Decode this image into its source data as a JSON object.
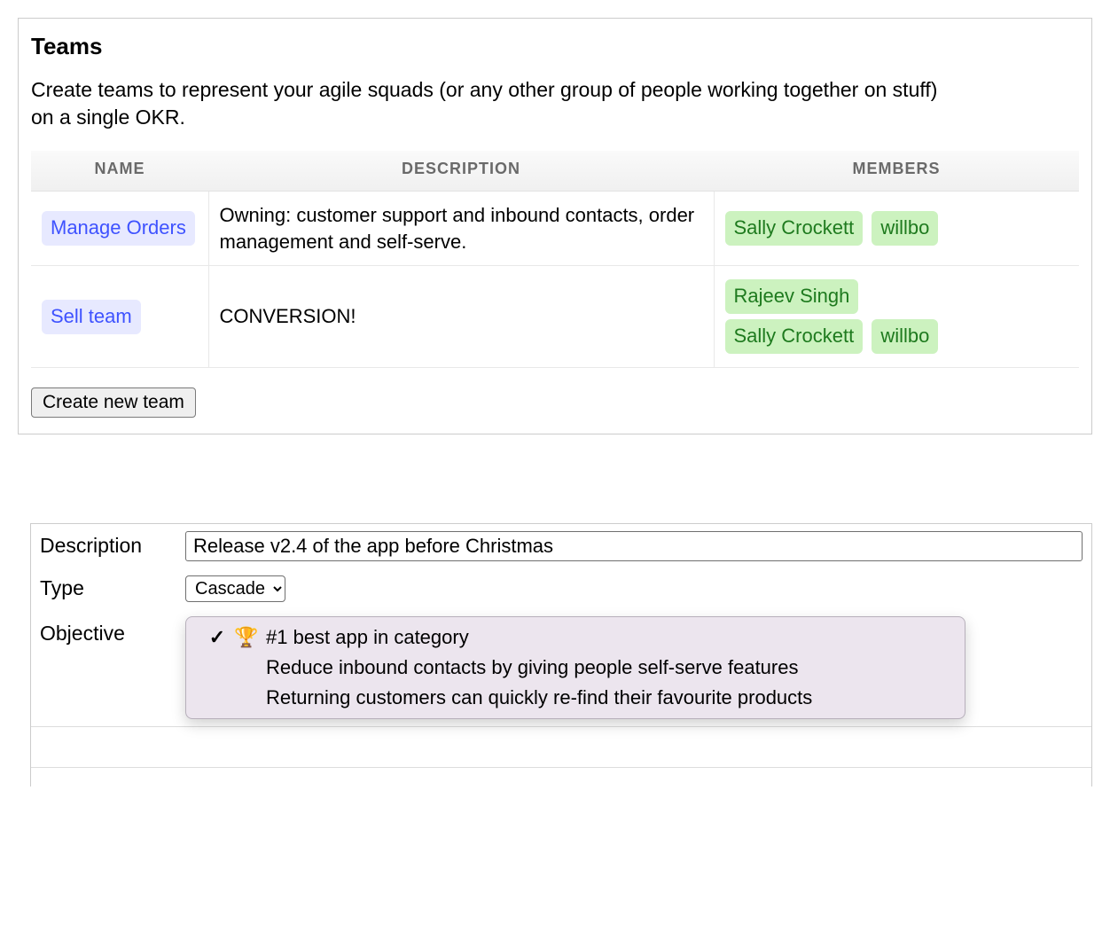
{
  "teams_panel": {
    "title": "Teams",
    "description_line1": "Create teams to represent your agile squads (or any other group of people working together on stuff)",
    "description_line2": "on a single OKR.",
    "columns": {
      "name": "Name",
      "description": "Description",
      "members": "Members"
    },
    "rows": [
      {
        "name": "Manage Orders",
        "description": "Owning: customer support and inbound contacts, order management and self-serve.",
        "members": [
          "Sally Crockett",
          "willbo"
        ]
      },
      {
        "name": "Sell team",
        "description": "CONVERSION!",
        "members": [
          "Rajeev Singh",
          "Sally Crockett",
          "willbo"
        ]
      }
    ],
    "create_button": "Create new team"
  },
  "form_panel": {
    "labels": {
      "description": "Description",
      "type": "Type",
      "objective": "Objective"
    },
    "description_value": "Release v2.4 of the app before Christmas",
    "type_value": "Cascade",
    "objective_options": [
      {
        "checked": true,
        "trophy": true,
        "label": "#1 best app in category"
      },
      {
        "checked": false,
        "trophy": false,
        "label": "Reduce inbound contacts by giving people self-serve features"
      },
      {
        "checked": false,
        "trophy": false,
        "label": "Returning customers can quickly re-find their favourite products"
      }
    ]
  },
  "glyphs": {
    "check": "✓",
    "trophy": "🏆"
  }
}
